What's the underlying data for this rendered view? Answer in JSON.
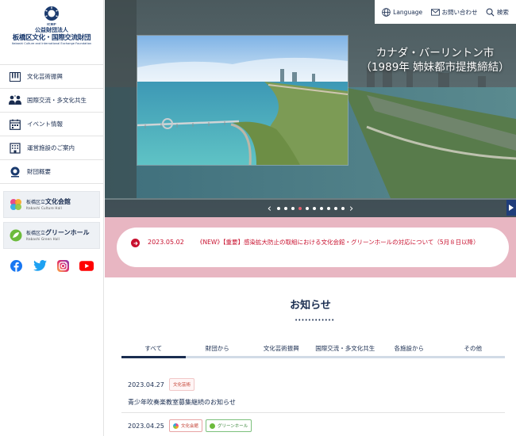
{
  "brand": {
    "emblem_text": "ICIEF",
    "org_type": "公益財団法人",
    "org_name": "板橋区文化・国際交流財団",
    "org_name_en": "Itabashi Culture and International Exchange Foundation"
  },
  "sidebar": {
    "items": [
      {
        "label": "文化芸術振興",
        "icon": "piano-keys-icon"
      },
      {
        "label": "国際交流・多文化共生",
        "icon": "people-exchange-icon"
      },
      {
        "label": "イベント情報",
        "icon": "calendar-icon"
      },
      {
        "label": "運営施設のご案内",
        "icon": "building-icon"
      },
      {
        "label": "財団概要",
        "icon": "foundation-emblem-icon"
      }
    ],
    "venues": [
      {
        "prefix": "板橋区立",
        "name": "文化会館",
        "en": "Itabashi Culture Hall"
      },
      {
        "prefix": "板橋区立",
        "name": "グリーンホール",
        "en": "Itabashi Green Hall"
      }
    ],
    "social": [
      "facebook-icon",
      "twitter-icon",
      "instagram-icon",
      "youtube-icon"
    ]
  },
  "utility": {
    "language": "Language",
    "contact": "お問い合わせ",
    "search": "検索"
  },
  "hero": {
    "caption_line1": "カナダ・バーリントン市",
    "caption_line2": "（1989年 姉妹都市提携締結）",
    "slide_count": 10,
    "active_slide": 4
  },
  "notice": {
    "date": "2023.05.02",
    "text": "《NEW》【重要】感染拡大防止の取組における文化会館・グリーンホールの対応について（5月８日以降）"
  },
  "news": {
    "title": "お知らせ",
    "tabs": [
      "すべて",
      "財団から",
      "文化芸術振興",
      "国際交流・多文化共生",
      "各施設から",
      "その他"
    ],
    "items": [
      {
        "date": "2023.04.27",
        "tags": [
          "文化芸術"
        ],
        "headline": "青少年吹奏楽教室募集継続のお知らせ"
      },
      {
        "date": "2023.04.25",
        "tags": [
          "文化会館",
          "グリーンホール"
        ],
        "headline": ""
      }
    ]
  },
  "colors": {
    "navy": "#1a2d50",
    "accent_red": "#c8102e",
    "notice_band": "#e8b6c2",
    "active_dot": "#e4606e",
    "green_tag": "#2f7f2f"
  }
}
